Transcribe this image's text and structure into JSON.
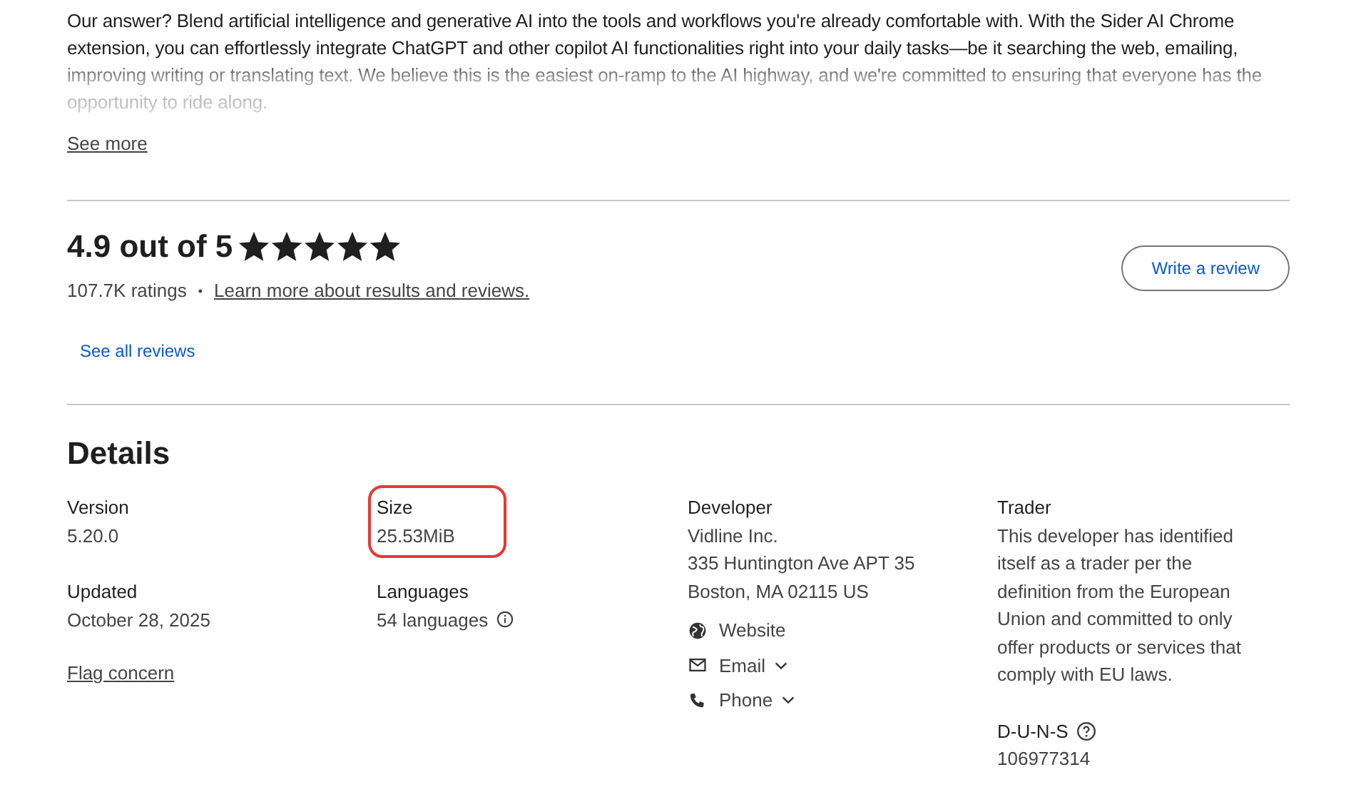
{
  "description": {
    "text": "Our answer? Blend artificial intelligence and generative AI into the tools and workflows you're already comfortable with. With the Sider AI Chrome extension, you can effortlessly integrate ChatGPT and other copilot AI functionalities right into your daily tasks—be it searching the web, emailing, improving writing or translating text. We believe this is the easiest on-ramp to the AI highway, and we're committed to ensuring that everyone has the opportunity to ride along.",
    "see_more": "See more"
  },
  "rating": {
    "title": "4.9 out of 5",
    "stars": 5,
    "count": "107.7K ratings",
    "separator": "•",
    "learn_more": "Learn more about results and reviews.",
    "write_review": "Write a review",
    "see_all": "See all reviews"
  },
  "details": {
    "title": "Details",
    "columns": [
      [
        {
          "label": "Version",
          "lines": [
            "5.20.0"
          ]
        },
        {
          "label": "Updated",
          "lines": [
            "October 28, 2025"
          ]
        }
      ],
      [
        {
          "label": "Size",
          "lines": [
            "25.53MiB"
          ],
          "highlighted": true
        },
        {
          "label": "Languages",
          "lines": [
            "54 languages"
          ],
          "info": true
        }
      ],
      [
        {
          "label": "Developer",
          "lines": [
            "Vidline Inc.",
            "335 Huntington Ave APT 35",
            "Boston, MA 02115 US"
          ],
          "links": [
            {
              "kind": "website",
              "label": "Website"
            },
            {
              "kind": "email",
              "label": "Email",
              "dropdown": true
            },
            {
              "kind": "phone",
              "label": "Phone",
              "dropdown": true
            }
          ]
        }
      ],
      [
        {
          "label": "Trader",
          "lines": [
            "This developer has identified itself as a trader per the definition from the European Union and committed to only offer products or services that comply with EU laws."
          ]
        },
        {
          "label": "D-U-N-S",
          "lines": [
            "106977314"
          ],
          "help": true
        }
      ]
    ],
    "flag": "Flag concern"
  }
}
